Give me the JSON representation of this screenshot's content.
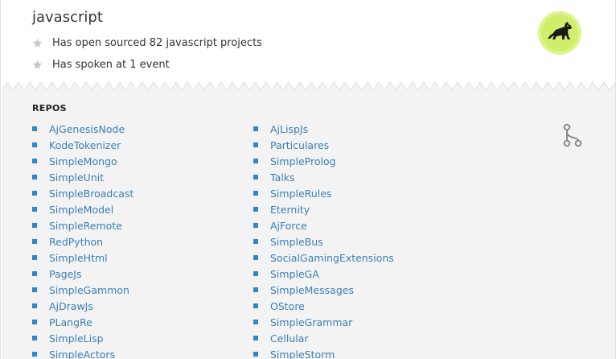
{
  "profile": {
    "language": "javascript",
    "achievements": [
      "Has open sourced 82 javascript projects",
      "Has spoken at 1 event"
    ]
  },
  "repos": {
    "heading": "REPOS",
    "left": [
      "AjGenesisNode",
      "KodeTokenizer",
      "SimpleMongo",
      "SimpleUnit",
      "SimpleBroadcast",
      "SimpleModel",
      "SimpleRemote",
      "RedPython",
      "SimpleHtml",
      "PageJs",
      "SimpleGammon",
      "AjDrawJs",
      "PLangRe",
      "SimpleLisp",
      "SimpleActors"
    ],
    "right": [
      "AjLispJs",
      "Particulares",
      "SimpleProlog",
      "Talks",
      "SimpleRules",
      "Eternity",
      "AjForce",
      "SimpleBus",
      "SocialGamingExtensions",
      "SimpleGA",
      "SimpleMessages",
      "OStore",
      "SimpleGrammar",
      "Cellular",
      "SimpleStorm"
    ]
  },
  "icons": {
    "achievement": "star-icon",
    "badge": "javascript-mascot-icon",
    "fork": "fork-icon"
  },
  "colors": {
    "link": "#3a7fb5",
    "bullet": "#2f86c8",
    "badge": "#cfee6b",
    "panel": "#f3f3f3"
  }
}
